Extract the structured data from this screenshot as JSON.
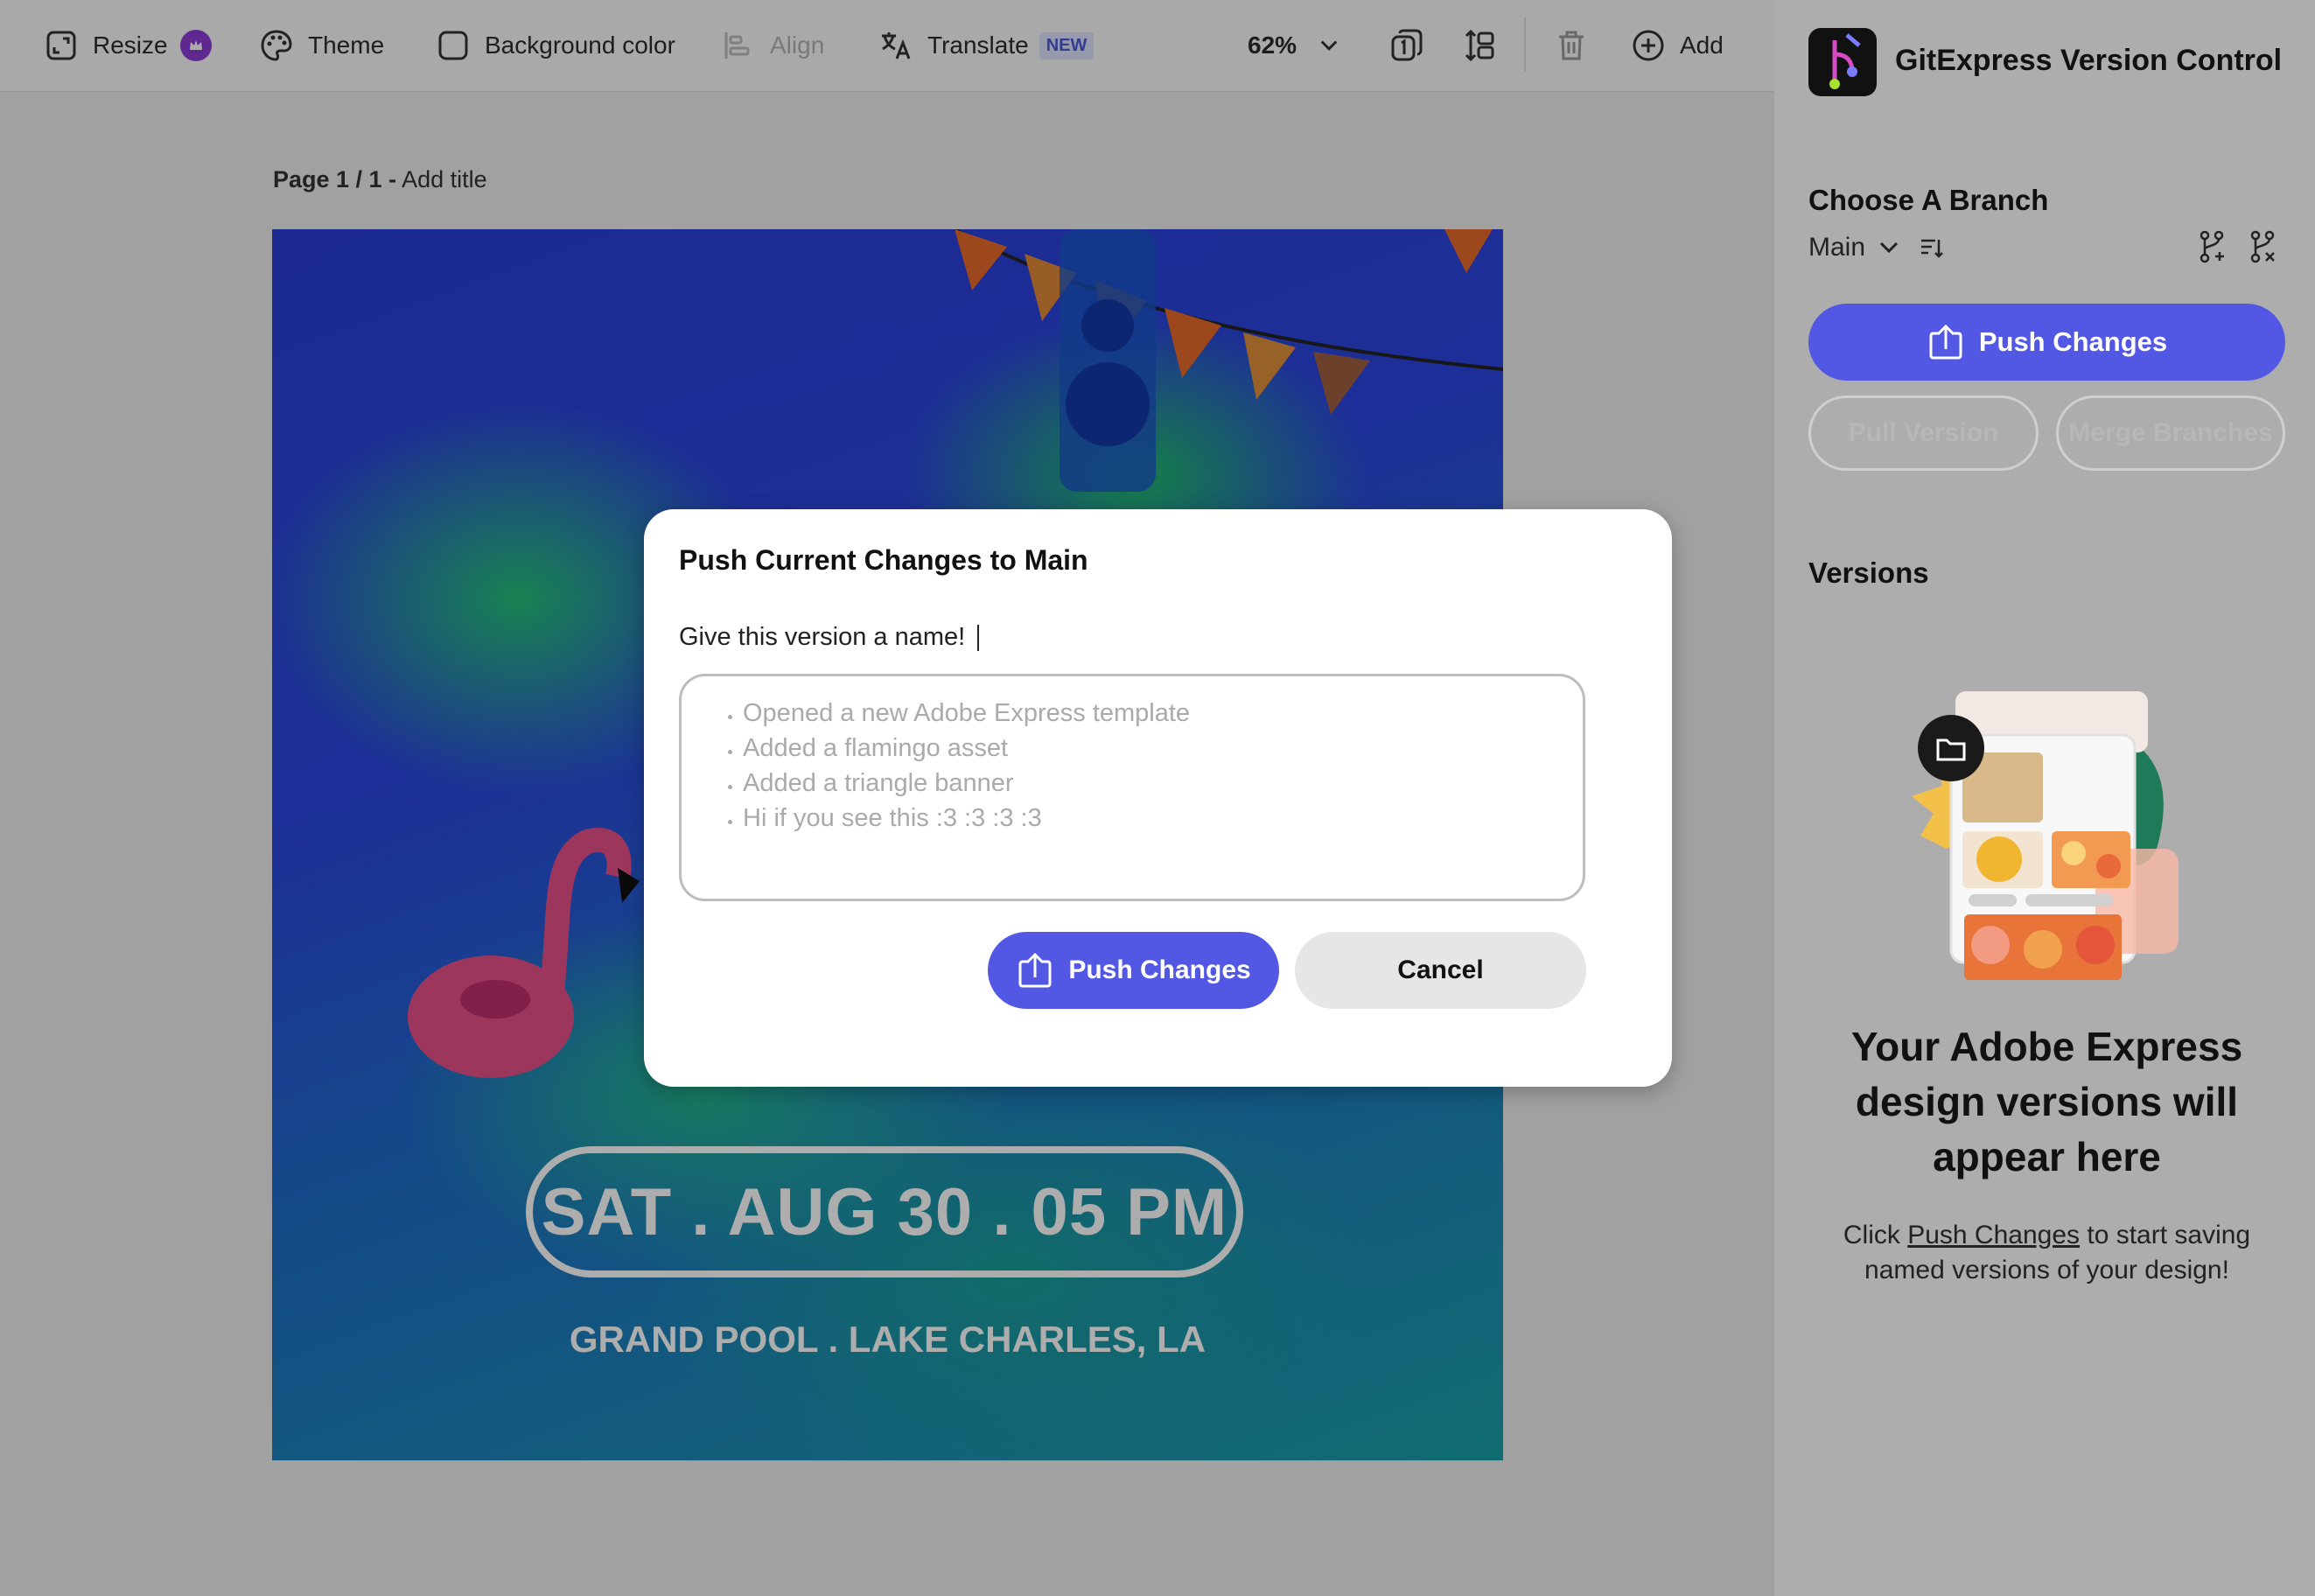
{
  "toolbar": {
    "resize_label": "Resize",
    "theme_label": "Theme",
    "background_label": "Background color",
    "align_label": "Align",
    "translate_label": "Translate",
    "translate_badge": "NEW",
    "zoom": "62%",
    "add_label": "Add"
  },
  "canvas": {
    "page_label": "Page 1 / 1 -",
    "page_title_placeholder": "Add title",
    "date_text": "SAT . AUG 30 . 05 PM",
    "venue_text": "GRAND POOL . LAKE CHARLES, LA"
  },
  "panel": {
    "title": "GitExpress Version Control",
    "branch_heading": "Choose A Branch",
    "branch_selected": "Main",
    "push_label": "Push Changes",
    "pull_label": "Pull Version",
    "merge_label": "Merge Branches",
    "versions_heading": "Versions",
    "empty_title": "Your Adobe Express design versions will appear here",
    "empty_text_before": "Click",
    "empty_text_link": "Push Changes",
    "empty_text_after": "to start saving named versions of your design!"
  },
  "modal": {
    "title": "Push Current Changes to Main",
    "name_label": "Give this version a name!",
    "placeholder_items": [
      "Opened a new Adobe Express template",
      "Added a flamingo asset",
      "Added a triangle banner",
      "Hi if you see this :3 :3 :3 :3"
    ],
    "push_label": "Push Changes",
    "cancel_label": "Cancel"
  },
  "colors": {
    "accent": "#5258e4",
    "artboard_blue": "#2c45e0",
    "artboard_green": "#25c07a"
  }
}
